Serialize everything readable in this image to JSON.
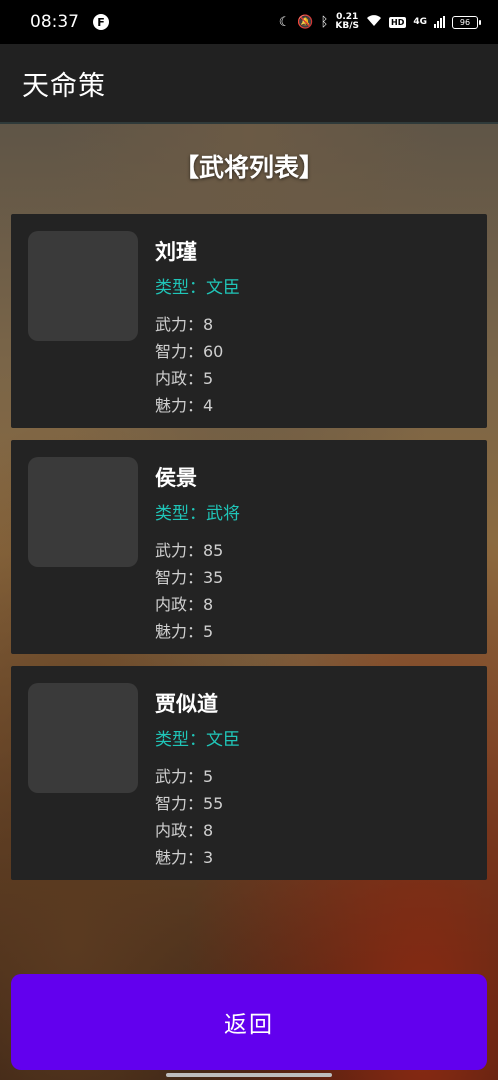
{
  "status_bar": {
    "time": "08:37",
    "net_speed_value": "0.21",
    "net_speed_unit": "KB/S",
    "hd": "HD",
    "network": "4G",
    "battery": "96"
  },
  "app": {
    "title": "天命策"
  },
  "section": {
    "title": "【武将列表】"
  },
  "generals": [
    {
      "name": "刘瑾",
      "type": "类型：文臣",
      "stats": [
        "武力：8",
        "智力：60",
        "内政：5",
        "魅力：4"
      ]
    },
    {
      "name": "侯景",
      "type": "类型：武将",
      "stats": [
        "武力：85",
        "智力：35",
        "内政：8",
        "魅力：5"
      ]
    },
    {
      "name": "贾似道",
      "type": "类型：文臣",
      "stats": [
        "武力：5",
        "智力：55",
        "内政：8",
        "魅力：3"
      ]
    }
  ],
  "footer": {
    "back_label": "返回"
  },
  "colors": {
    "accent": "#6200ee",
    "type_text": "#20c5b8",
    "card_bg": "#232323",
    "app_bar_bg": "#212121"
  }
}
